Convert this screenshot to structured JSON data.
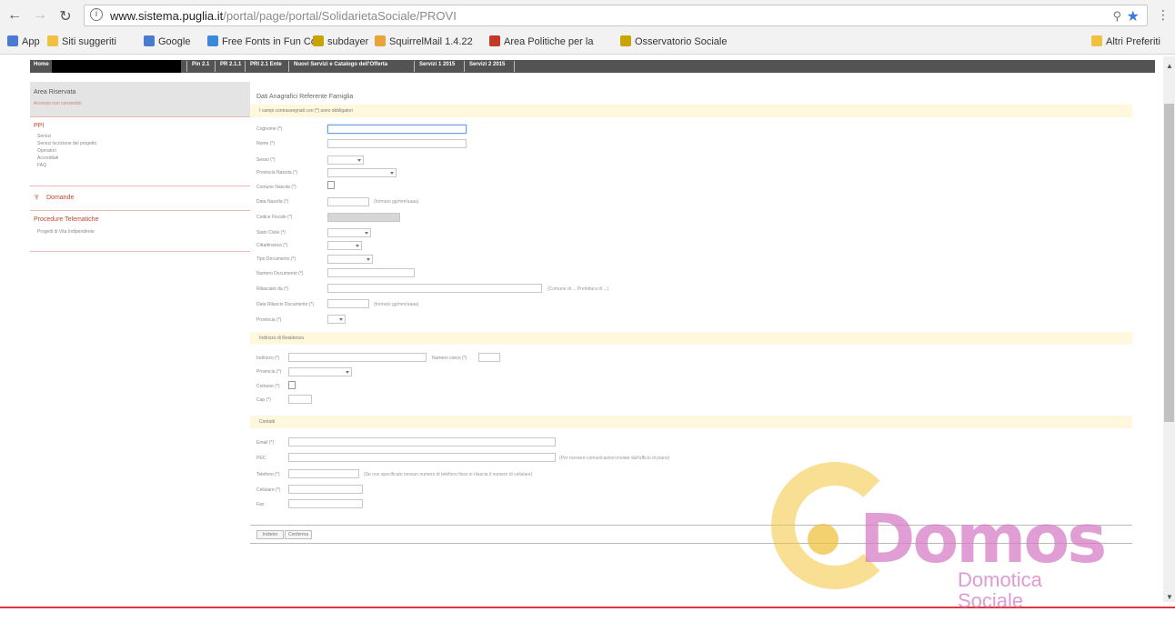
{
  "browser": {
    "url_domain": "www.sistema.puglia.it",
    "url_path": "/portal/page/portal/SolidarietaSociale/PROVI",
    "bookmarks": [
      {
        "label": "App",
        "color": "#4a7bd0"
      },
      {
        "label": "Siti suggeriti",
        "color": "#f0c040"
      },
      {
        "label": "Google",
        "color": "#4a7bd0"
      },
      {
        "label": "Free Fonts in Fun Col",
        "color": "#3b8ad8"
      },
      {
        "label": "subdayer",
        "color": "#c9a400"
      },
      {
        "label": "SquirrelMail 1.4.22",
        "color": "#e8a33b"
      },
      {
        "label": "Area Politiche per la",
        "color": "#c0392b"
      },
      {
        "label": "Osservatorio Sociale",
        "color": "#c9a400"
      }
    ],
    "other_bookmarks": "Altri Preferiti"
  },
  "topnav": {
    "items": [
      "Home",
      "Pin 2.1",
      "PR 2.1.1",
      "PRI 2.1 Ente",
      "Nuovi Servizi e Catalogo dell'Offerta",
      "Servizi 1 2015",
      "Servizi 2 2015"
    ]
  },
  "sidebar": {
    "area_title": "Area Riservata",
    "area_sub": "Accesso non consentito",
    "section1_title": "PPI",
    "section1_links": [
      "Servizi",
      "Servizi Iscrizione del progetto",
      "Operatori",
      "Accreditati",
      "FAQ"
    ],
    "section2_title": "Domande",
    "section3_title": "Procedure Telematiche",
    "section3_links": [
      "Progetti di Vita Indipendente"
    ]
  },
  "form": {
    "title": "Dati Anagrafici Referente Famiglia",
    "required_note": "I campi contrassegnati con (*) sono obbligatori",
    "fields1": [
      "Cognome (*)",
      "Nome (*)",
      "Sesso (*)",
      "Provincia Nascita (*)",
      "Comune Nascita (*)",
      "Data Nascita (*)",
      "Codice Fiscale (*)",
      "Stato Civile (*)",
      "Cittadinanza (*)",
      "Tipo Documento (*)",
      "Numero Documento (*)",
      "Rilasciato da (*)",
      "Data Rilascio Documento (*)",
      "Provincia (*)"
    ],
    "date_hint": "(formato gg/mm/aaaa)",
    "rilascio_hint": "(formato gg/mm/aaaa)",
    "rilasciato_hint": "(Comune di ... Prefettura di ...)",
    "section_residence": "Indirizzo di Residenza",
    "res_fields": [
      "Indirizzo (*)",
      "Provincia (*)",
      "Comune (*)",
      "Cap (*)"
    ],
    "civic_label": "Numero civico (*)",
    "section_contacts": "Contatti",
    "contact_fields": [
      "Email (*)",
      "PEC",
      "Telefono (*)",
      "Cellulare (*)",
      "Fax"
    ],
    "pec_hint": "(Per ricevere comunicazioni inviate dall'ufficio di piano)",
    "phone_hint": "(Se non specificato nessun numero di telefono fisso si rilascia il numero di cellulare)",
    "buttons": [
      "Indietro",
      "Conferma"
    ]
  },
  "watermark": {
    "word": "Domos",
    "sub1": "Domotica",
    "sub2": "Sociale"
  }
}
